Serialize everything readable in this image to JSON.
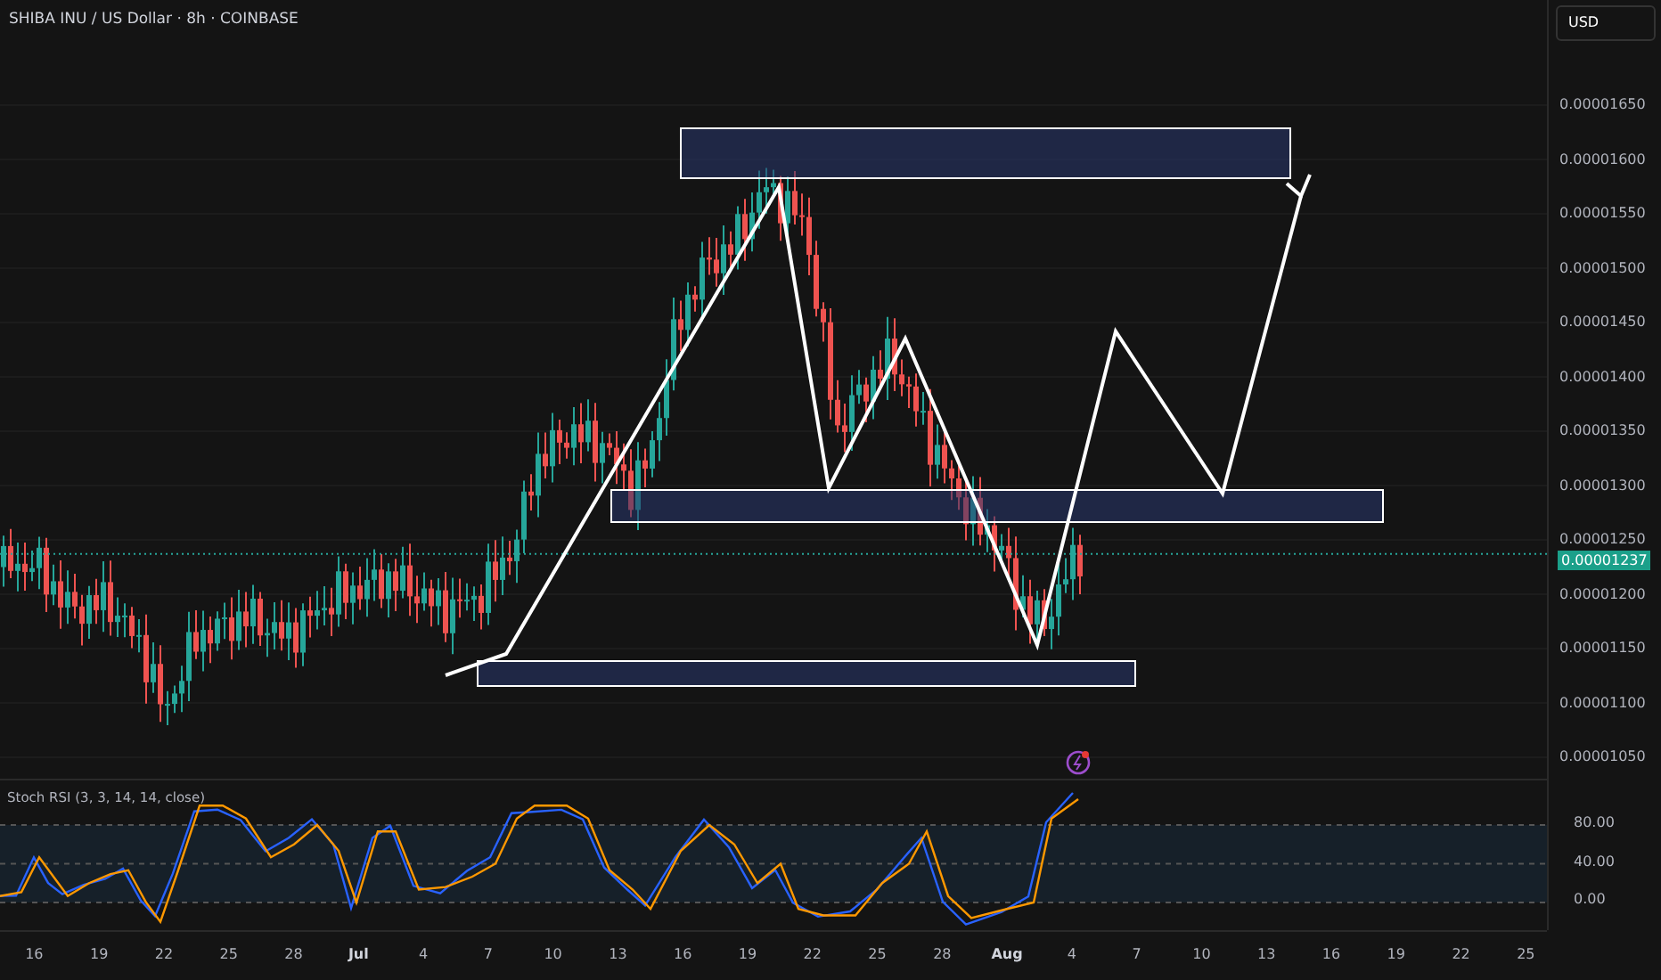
{
  "header": {
    "title": "SHIBA INU / US Dollar · 8h · COINBASE",
    "currency": "USD"
  },
  "price_axis": {
    "labels": [
      "0.00001650",
      "0.00001600",
      "0.00001550",
      "0.00001500",
      "0.00001450",
      "0.00001400",
      "0.00001350",
      "0.00001300",
      "0.00001250",
      "0.00001200",
      "0.00001150",
      "0.00001100",
      "0.00001050"
    ],
    "last_price": "0.00001237"
  },
  "indicator": {
    "name": "Stoch RSI (3, 3, 14, 14, close)",
    "axis_labels": [
      "80.00",
      "40.00",
      "0.00"
    ]
  },
  "time_axis": {
    "labels": [
      "16",
      "19",
      "22",
      "25",
      "28",
      "Jul",
      "4",
      "7",
      "10",
      "13",
      "16",
      "19",
      "22",
      "25",
      "28",
      "Aug",
      "4",
      "7",
      "10",
      "13",
      "16",
      "19",
      "22",
      "25"
    ]
  }
}
